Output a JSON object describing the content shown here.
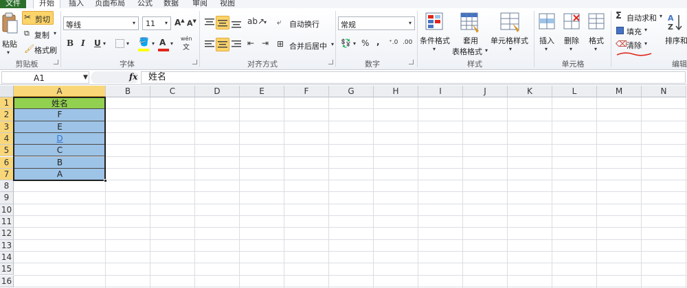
{
  "menu": {
    "file": "文件",
    "home": "开始",
    "insert": "插入",
    "layout": "页面布局",
    "formula": "公式",
    "data": "数据",
    "review": "审阅",
    "view": "视图"
  },
  "ribbon": {
    "clipboard": {
      "paste": "粘贴",
      "cut": "剪切",
      "copy": "复制",
      "format_painter": "格式刷",
      "label": "剪贴板"
    },
    "font": {
      "font_name": "等线",
      "font_size": "11",
      "bold": "B",
      "italic": "I",
      "underline": "U",
      "font_color_letter": "A",
      "phonetic": "wén",
      "label": "字体"
    },
    "alignment": {
      "wrap_text": "自动换行",
      "merge_center": "合并后居中",
      "label": "对齐方式"
    },
    "number": {
      "format": "常规",
      "percent": "%",
      "comma": ",",
      "label": "数字"
    },
    "styles": {
      "conditional": "条件格式",
      "table_line1": "套用",
      "table_line2": "表格格式",
      "cell_styles": "单元格样式",
      "label": "样式"
    },
    "cells": {
      "insert": "插入",
      "delete": "删除",
      "format": "格式",
      "label": "单元格"
    },
    "editing": {
      "autosum": "自动求和",
      "fill": "填充",
      "clear": "清除",
      "sort": "排序和",
      "label": "编辑"
    }
  },
  "formula_bar": {
    "name_box": "A1",
    "fx": "fx",
    "content": "姓名"
  },
  "sheet": {
    "columns": [
      "A",
      "B",
      "C",
      "D",
      "E",
      "F",
      "G",
      "H",
      "I",
      "J",
      "K",
      "L",
      "M",
      "N"
    ],
    "rows": [
      "1",
      "2",
      "3",
      "4",
      "5",
      "6",
      "7",
      "8",
      "9",
      "10",
      "11",
      "12",
      "13",
      "14",
      "15",
      "16"
    ],
    "column_a": [
      "姓名",
      "F",
      "E",
      "D",
      "C",
      "B",
      "A"
    ],
    "header_fill": "#92d050",
    "data_fill": "#9dc3e6",
    "link_color": "#2e75d4"
  }
}
